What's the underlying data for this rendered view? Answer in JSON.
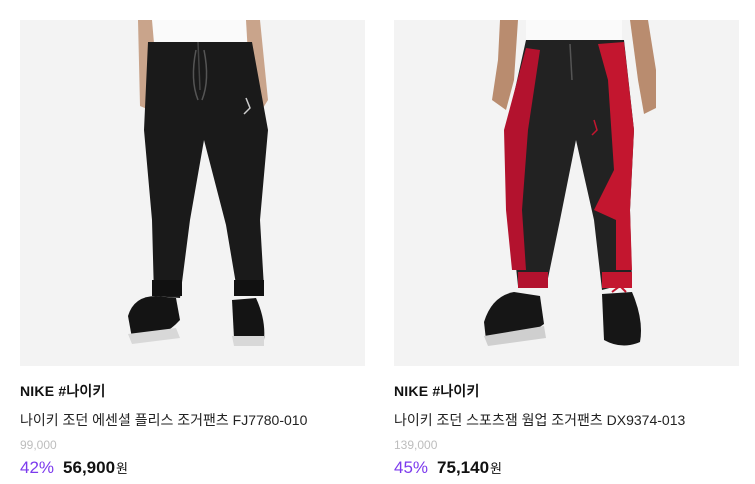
{
  "products": [
    {
      "brand": "NIKE #나이키",
      "name": "나이키 조던 에센셜 플리스 조거팬츠 FJ7780-010",
      "original_price": "99,000",
      "discount": "42%",
      "price": "56,900",
      "currency": "원",
      "image": "black-fleece-jogger-pants"
    },
    {
      "brand": "NIKE #나이키",
      "name": "나이키 조던 스포츠잼 웜업 조거팬츠 DX9374-013",
      "original_price": "139,000",
      "discount": "45%",
      "price": "75,140",
      "currency": "원",
      "image": "black-red-warmup-jogger-pants"
    }
  ],
  "colors": {
    "discount": "#7c3aed",
    "original_price": "#bdbdbd",
    "image_bg": "#f3f3f3"
  }
}
